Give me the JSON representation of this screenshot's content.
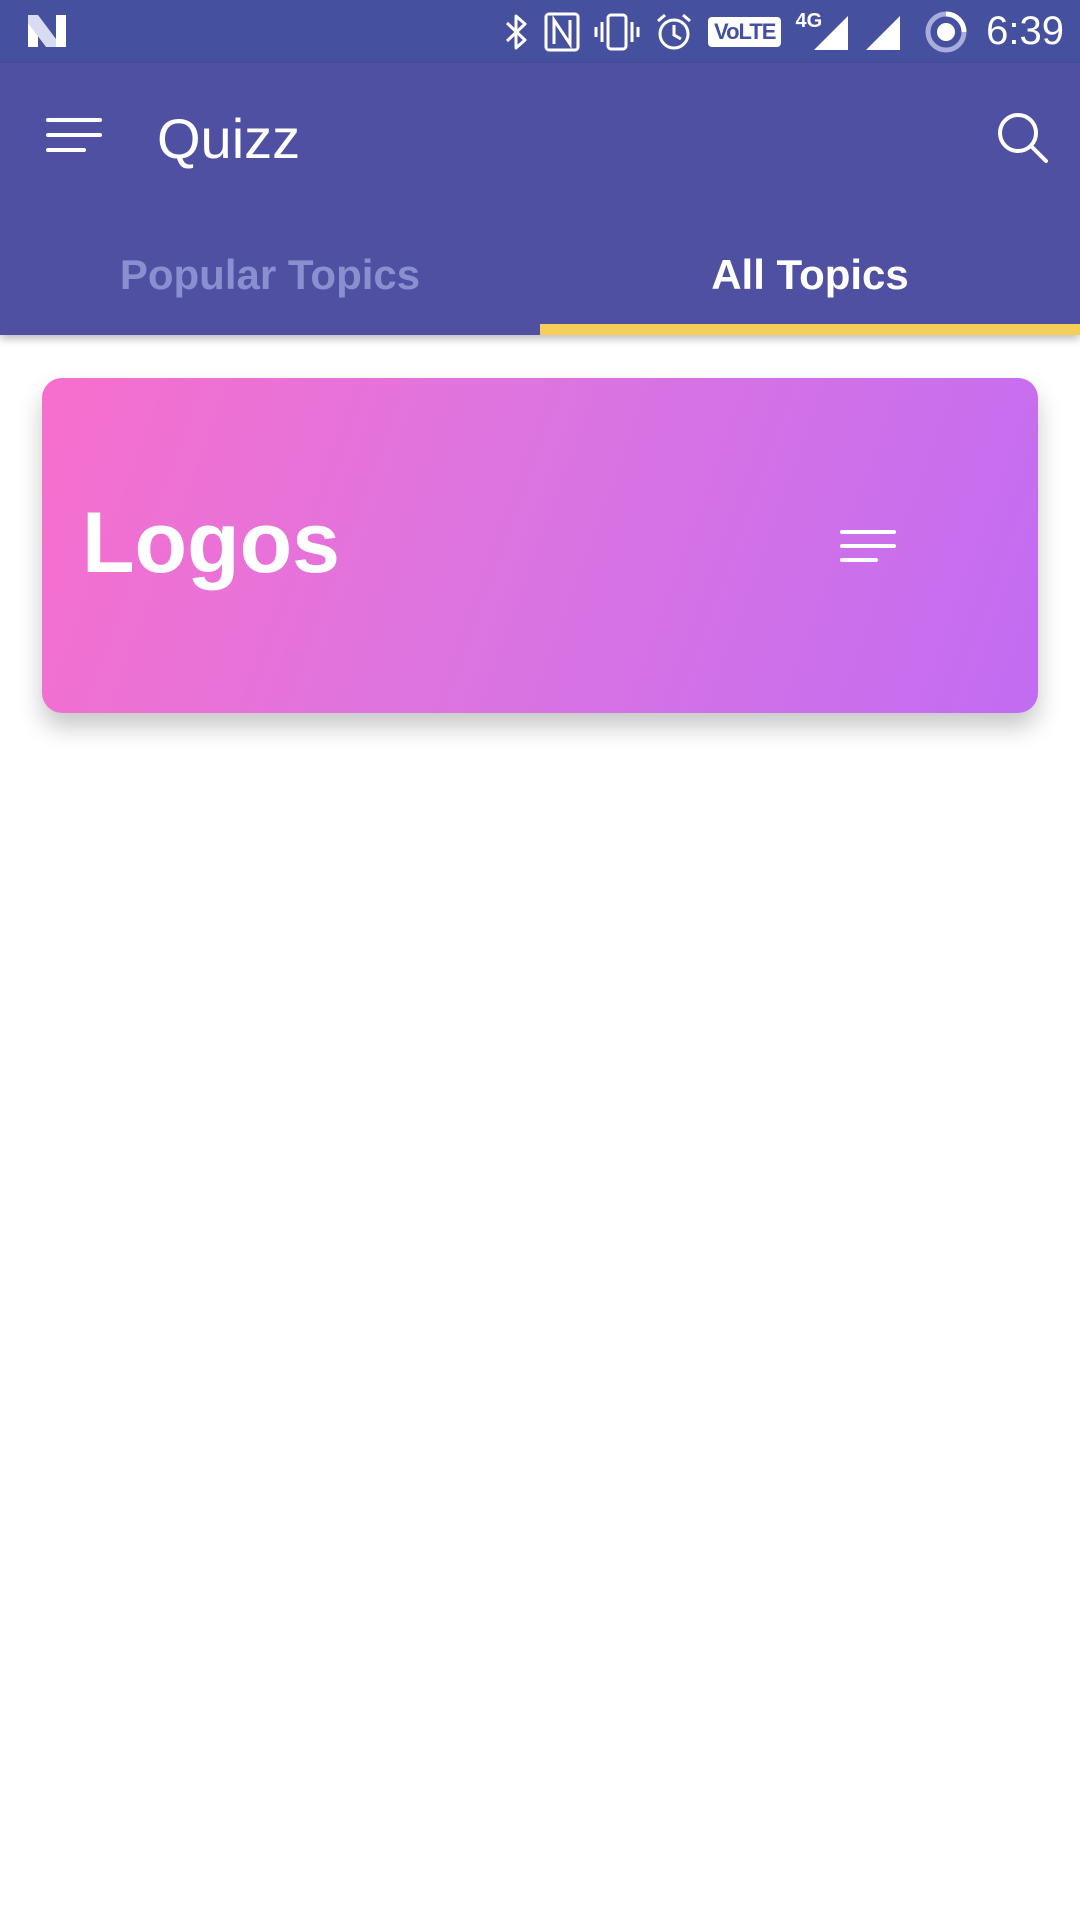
{
  "status_bar": {
    "time": "6:39",
    "volte_label": "VoLTE",
    "network_label": "4G",
    "icons": [
      "n-logo-icon",
      "bluetooth-icon",
      "nfc-icon",
      "vibrate-icon",
      "alarm-icon",
      "volte-icon",
      "signal-4g-icon",
      "signal-icon",
      "battery-saver-icon"
    ]
  },
  "app_bar": {
    "title": "Quizz",
    "menu_icon": "menu-icon",
    "search_icon": "search-icon"
  },
  "tabs": [
    {
      "label": "Popular Topics",
      "active": false
    },
    {
      "label": "All Topics",
      "active": true
    }
  ],
  "topics": [
    {
      "title": "Logos",
      "icon": "menu-lines-icon"
    }
  ],
  "colors": {
    "status_bar": "#45509f",
    "app_bar": "#5050a3",
    "tab_indicator": "#f6cf5b",
    "tab_inactive_text": "#8a8fd0",
    "card_gradient_start": "#f76fcd",
    "card_gradient_end": "#c26cf2"
  }
}
